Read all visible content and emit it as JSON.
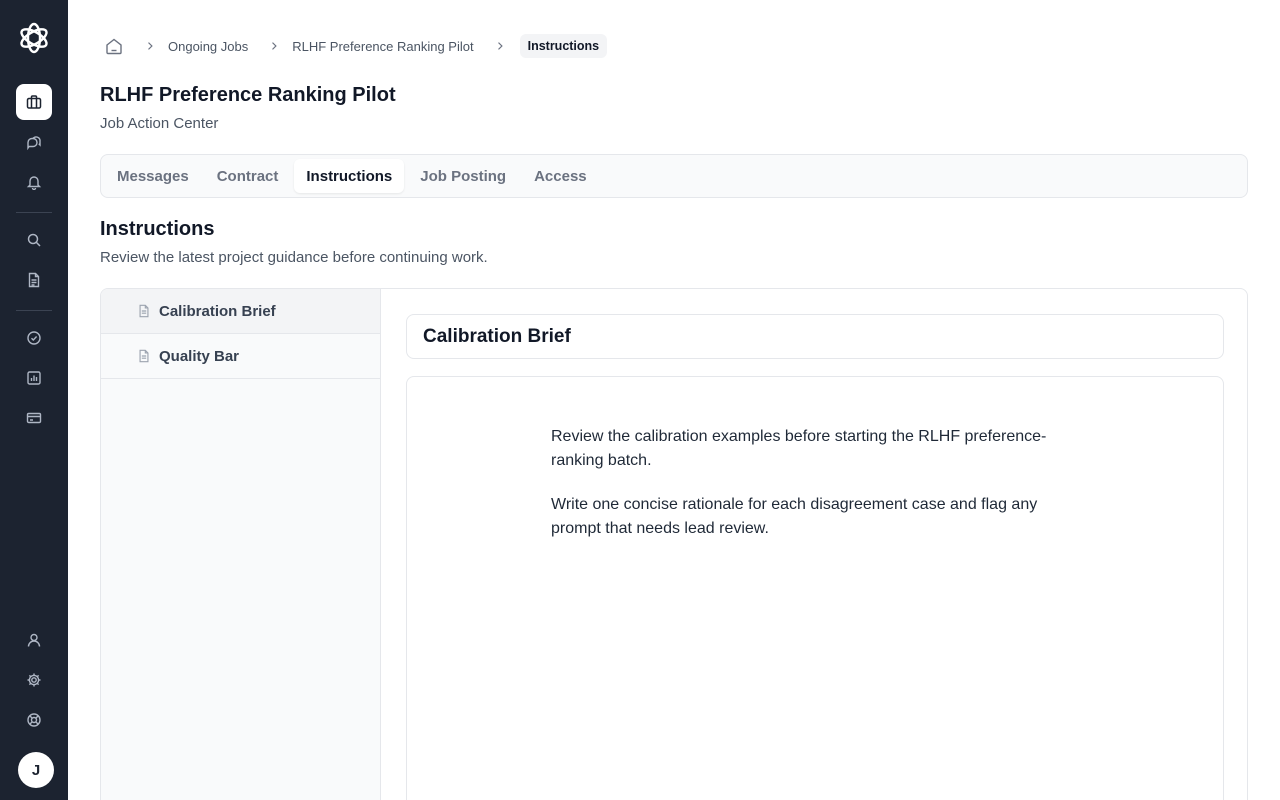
{
  "sidebar": {
    "logo_icon": "asterisk-logo-icon",
    "nav": [
      {
        "name": "jobs",
        "icon": "briefcase-icon",
        "active": true
      },
      {
        "name": "messages",
        "icon": "chat-bubbles-icon"
      },
      {
        "name": "notifications",
        "icon": "bell-icon"
      },
      {
        "name": "search",
        "icon": "search-icon"
      },
      {
        "name": "documents",
        "icon": "document-icon"
      },
      {
        "name": "tasks",
        "icon": "check-circle-icon"
      },
      {
        "name": "analytics",
        "icon": "bar-chart-icon"
      },
      {
        "name": "payments",
        "icon": "credit-card-icon"
      },
      {
        "name": "profile",
        "icon": "user-icon"
      },
      {
        "name": "settings",
        "icon": "gear-icon"
      },
      {
        "name": "help",
        "icon": "lifebuoy-icon"
      }
    ],
    "avatar_initial": "J"
  },
  "breadcrumb": {
    "home_icon": "home-icon",
    "items": [
      "Ongoing Jobs",
      "RLHF Preference Ranking Pilot"
    ],
    "current": "Instructions"
  },
  "page": {
    "title": "RLHF Preference Ranking Pilot",
    "subtitle": "Job Action Center"
  },
  "tabs": [
    "Messages",
    "Contract",
    "Instructions",
    "Job Posting",
    "Access"
  ],
  "active_tab": "Instructions",
  "section": {
    "title": "Instructions",
    "description": "Review the latest project guidance before continuing work."
  },
  "documents": {
    "items": [
      "Calibration Brief",
      "Quality Bar"
    ],
    "selected": "Calibration Brief",
    "viewer_title": "Calibration Brief",
    "paragraphs": [
      "Review the calibration examples before starting the RLHF preference-ranking batch.",
      "Write one concise rationale for each disagreement case and flag any prompt that needs lead review."
    ]
  },
  "colors": {
    "sidebar_bg": "#1c2330",
    "sidebar_icon": "#aeb6c4",
    "active_icon": "#1c2330"
  }
}
